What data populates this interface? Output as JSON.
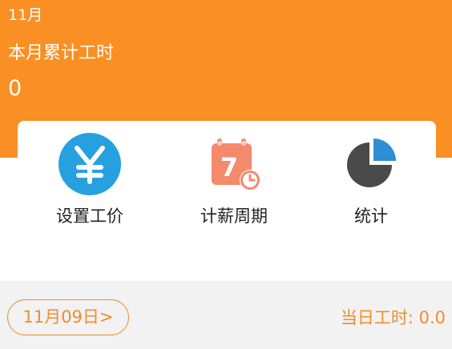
{
  "header": {
    "month": "11月",
    "total_label": "本月累计工时",
    "total_value": "0"
  },
  "actions": [
    {
      "label": "设置工价",
      "icon": "yen-icon"
    },
    {
      "label": "计薪周期",
      "icon": "calendar-icon",
      "icon_text": "7"
    },
    {
      "label": "统计",
      "icon": "pie-chart-icon"
    }
  ],
  "footer": {
    "date_label": "11月09日>",
    "day_hours": "当日工时: 0.0"
  },
  "colors": {
    "brand": "#fa8f23",
    "accent_text": "#f08c2c",
    "yen_icon_bg": "#27a0df",
    "calendar_icon": "#f5896b",
    "pie_dark": "#4a4a4a",
    "pie_slice": "#2f8ed3"
  }
}
